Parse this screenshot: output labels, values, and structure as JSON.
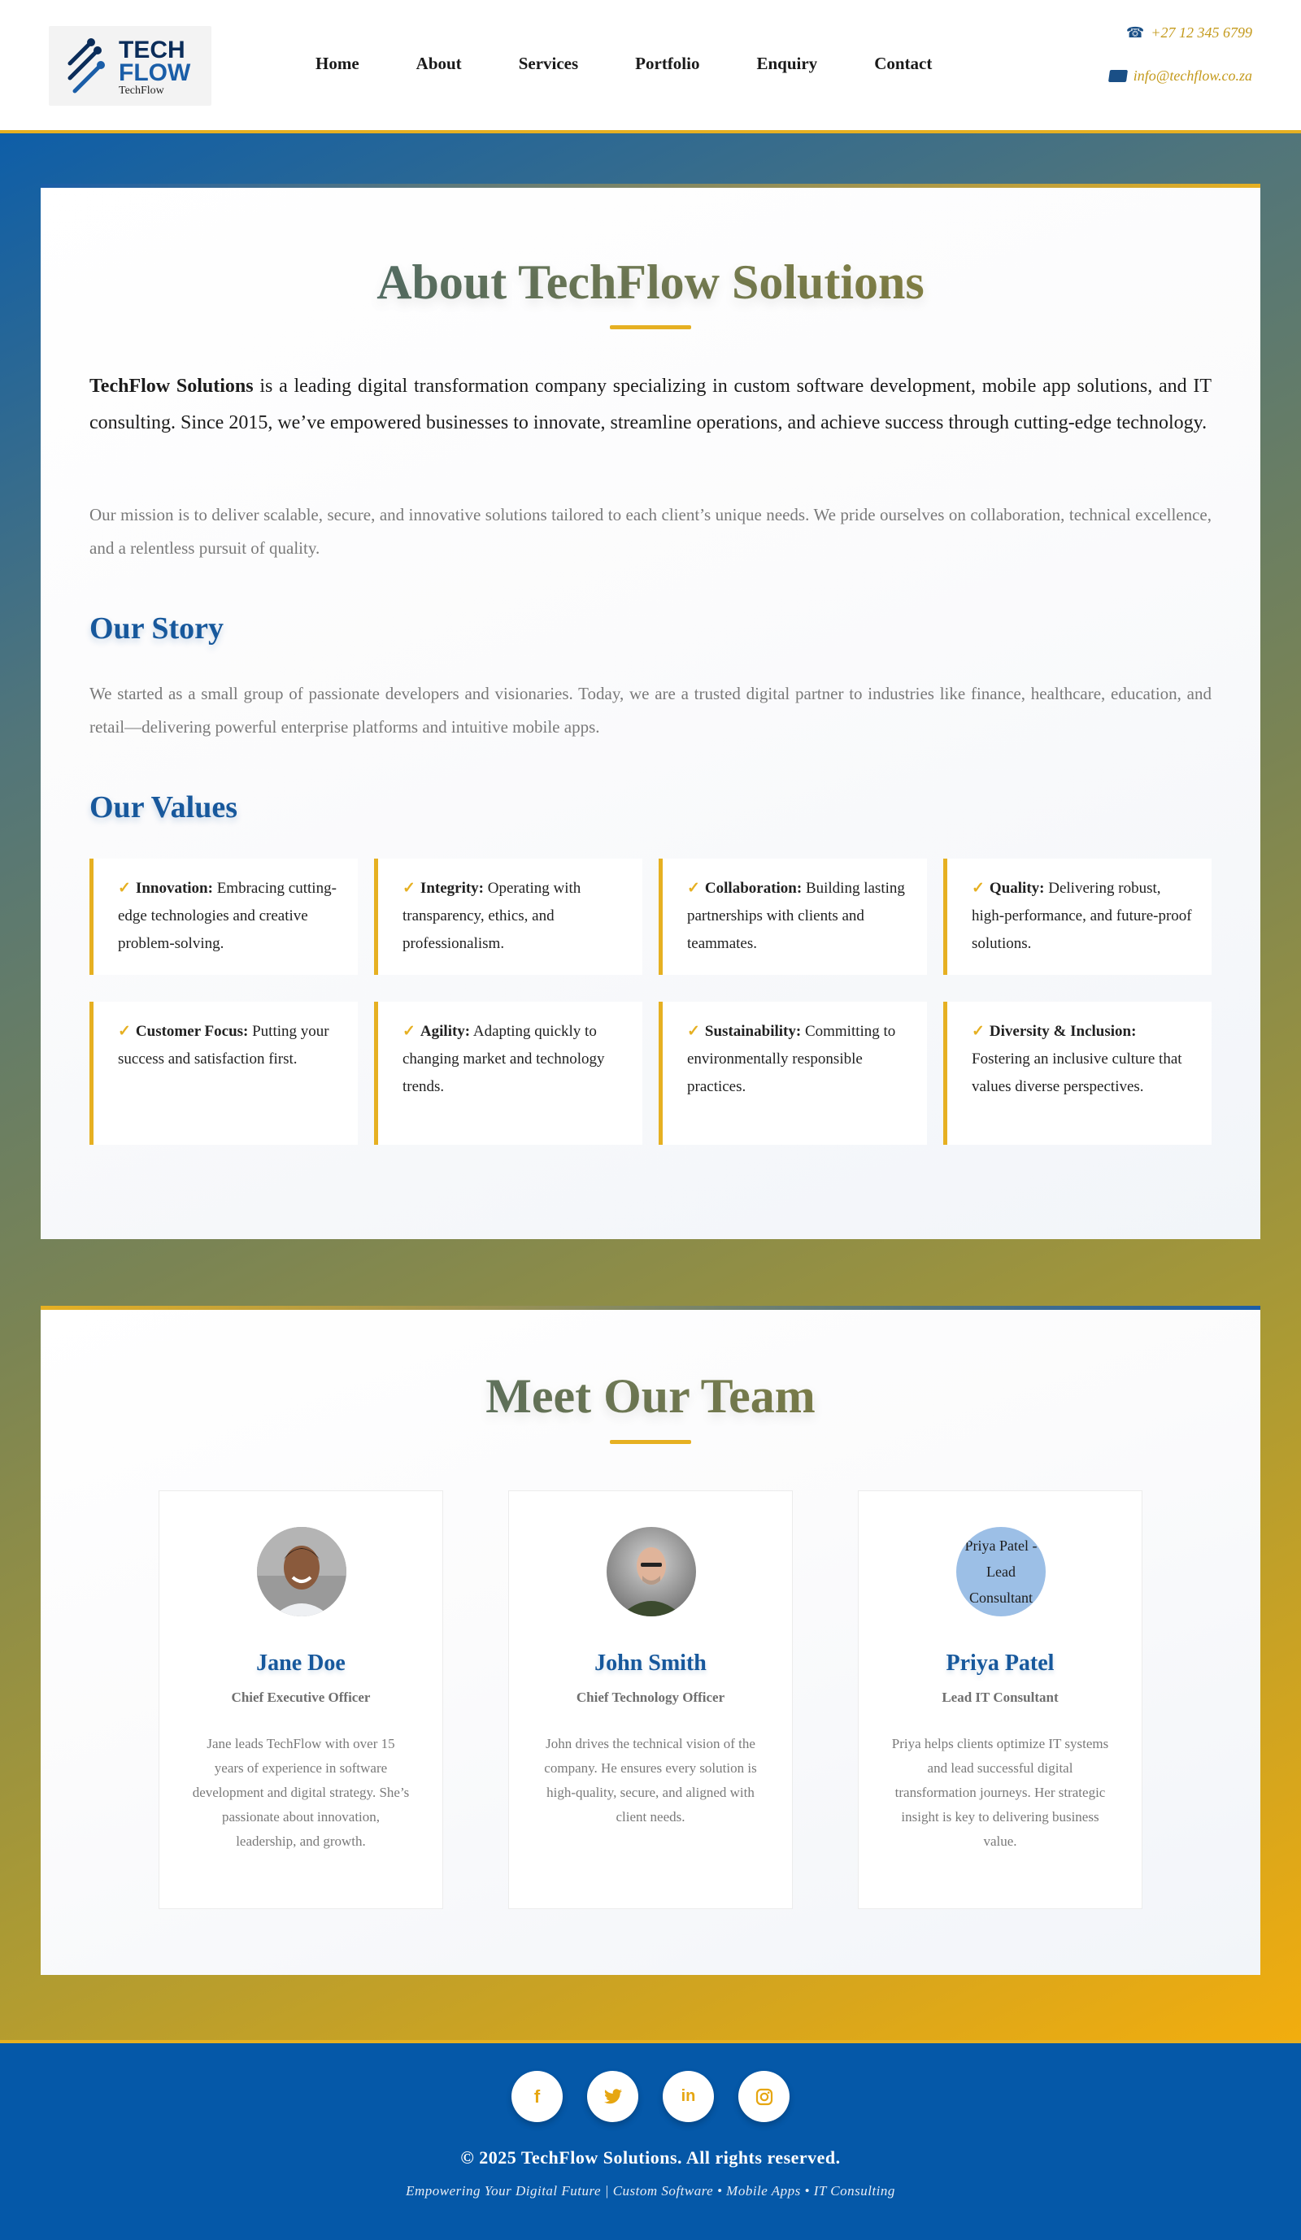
{
  "header": {
    "logo": {
      "line1": "TECH",
      "line2": "FLOW",
      "sub": "TechFlow"
    },
    "nav": [
      "Home",
      "About",
      "Services",
      "Portfolio",
      "Enquiry",
      "Contact"
    ],
    "phone": "+27 12 345 6799",
    "email": "info@techflow.co.za"
  },
  "about": {
    "title": "About TechFlow Solutions",
    "intro_bold": "TechFlow Solutions",
    "intro_rest": " is a leading digital transformation company specializing in custom software development, mobile app solutions, and IT consulting. Since 2015, we’ve empowered businesses to innovate, streamline operations, and achieve success through cutting-edge technology.",
    "mission": "Our mission is to deliver scalable, secure, and innovative solutions tailored to each client’s unique needs. We pride ourselves on collaboration, technical excellence, and a relentless pursuit of quality.",
    "story_title": "Our Story",
    "story_text": "We started as a small group of passionate developers and visionaries. Today, we are a trusted digital partner to industries like finance, healthcare, education, and retail—delivering powerful enterprise platforms and intuitive mobile apps.",
    "values_title": "Our Values",
    "check": "✓",
    "values": [
      {
        "name": "Innovation:",
        "text": " Embracing cutting-edge technologies and creative problem-solving."
      },
      {
        "name": "Integrity:",
        "text": " Operating with transparency, ethics, and professionalism."
      },
      {
        "name": "Collaboration:",
        "text": " Building lasting partnerships with clients and teammates."
      },
      {
        "name": "Quality:",
        "text": " Delivering robust, high-performance, and future-proof solutions."
      },
      {
        "name": "Customer Focus:",
        "text": " Putting your success and satisfaction first."
      },
      {
        "name": "Agility:",
        "text": " Adapting quickly to changing market and technology trends."
      },
      {
        "name": "Sustainability:",
        "text": " Committing to environmentally responsible practices."
      },
      {
        "name": "Diversity & Inclusion:",
        "text": " Fostering an inclusive culture that values diverse perspectives."
      }
    ]
  },
  "team": {
    "title": "Meet Our Team",
    "members": [
      {
        "name": "Jane Doe",
        "role": "Chief Executive Officer",
        "bio": "Jane leads TechFlow with over 15 years of experience in software development and digital strategy. She’s passionate about innovation, leadership, and growth."
      },
      {
        "name": "John Smith",
        "role": "Chief Technology Officer",
        "bio": "John drives the technical vision of the company. He ensures every solution is high-quality, secure, and aligned with client needs."
      },
      {
        "name": "Priya Patel",
        "role": "Lead IT Consultant",
        "bio": "Priya helps clients optimize IT systems and lead successful digital transformation journeys. Her strategic insight is key to delivering business value.",
        "photo_alt": "Priya Patel - Lead Consultant"
      }
    ]
  },
  "footer": {
    "socials": [
      {
        "icon": "facebook-icon",
        "glyph": "f"
      },
      {
        "icon": "twitter-icon",
        "glyph": "🐦"
      },
      {
        "icon": "linkedin-icon",
        "glyph": "in"
      },
      {
        "icon": "instagram-icon",
        "glyph": "◎"
      }
    ],
    "copyright": "© 2025 TechFlow Solutions. All rights reserved.",
    "tagline": "Empowering Your Digital Future | Custom Software • Mobile Apps • IT Consulting"
  },
  "colors": {
    "brand_blue": "#17589c",
    "accent_gold": "#e6b022",
    "footer_blue": "#0558a8"
  }
}
